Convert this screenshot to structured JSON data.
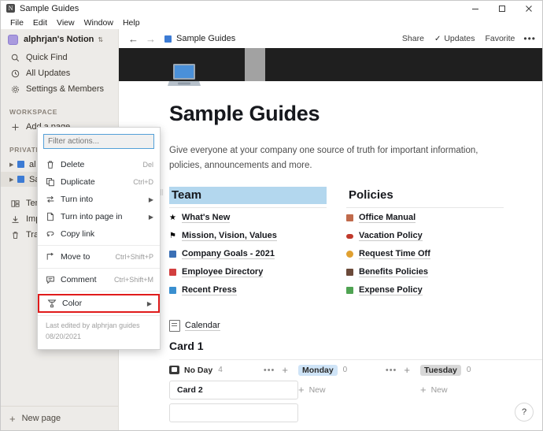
{
  "window": {
    "title": "Sample Guides",
    "app_icon": "notion-logo-icon",
    "minimize": "minimize-icon",
    "maximize": "maximize-icon",
    "close": "close-icon"
  },
  "menubar": {
    "items": [
      "File",
      "Edit",
      "View",
      "Window",
      "Help"
    ]
  },
  "sidebar": {
    "workspace_name": "alphrjan's Notion",
    "nav": [
      {
        "label": "Quick Find",
        "icon": "search-icon"
      },
      {
        "label": "All Updates",
        "icon": "clock-icon"
      },
      {
        "label": "Settings & Members",
        "icon": "gear-icon"
      }
    ],
    "workspace_section": "WORKSPACE",
    "add_page": "Add a page",
    "private_section": "PRIVATE",
    "tree": [
      {
        "label": "al",
        "icon": "page-icon",
        "selected": false
      },
      {
        "label": "Sa",
        "icon": "page-icon",
        "selected": true
      }
    ],
    "bottom": [
      {
        "label": "Temp",
        "icon": "templates-icon"
      },
      {
        "label": "Impo",
        "icon": "import-icon"
      },
      {
        "label": "Trash",
        "icon": "trash-icon"
      }
    ],
    "new_page": "New page"
  },
  "topbar": {
    "back": "back-arrow-icon",
    "forward": "forward-arrow-icon",
    "breadcrumb": "Sample Guides",
    "share": "Share",
    "updates": "Updates",
    "favorite": "Favorite",
    "more": "•••"
  },
  "page": {
    "title": "Sample Guides",
    "description": "Give everyone at your company one source of truth for important information, policies, announcements and more.",
    "cover_icon": "laptop-emoji"
  },
  "columns": [
    {
      "heading": "Team",
      "highlighted": true,
      "links": [
        {
          "label": "What's New",
          "icon": "star-emoji",
          "color": "#f0a81e"
        },
        {
          "label": "Mission, Vision, Values",
          "icon": "flag-emoji",
          "color": "#e04b5a"
        },
        {
          "label": "Company Goals - 2021",
          "icon": "car-emoji",
          "color": "#3a6fb5"
        },
        {
          "label": "Employee Directory",
          "icon": "toolbox-emoji",
          "color": "#d23f3f"
        },
        {
          "label": "Recent Press",
          "icon": "megaphone-emoji",
          "color": "#3a8fd0"
        }
      ]
    },
    {
      "heading": "Policies",
      "highlighted": false,
      "links": [
        {
          "label": "Office Manual",
          "icon": "book-emoji",
          "color": "#c06a4b"
        },
        {
          "label": "Vacation Policy",
          "icon": "car-emoji",
          "color": "#c0392b"
        },
        {
          "label": "Request Time Off",
          "icon": "bell-emoji",
          "color": "#e0a030"
        },
        {
          "label": "Benefits Policies",
          "icon": "coffee-emoji",
          "color": "#6b4a3a"
        },
        {
          "label": "Expense Policy",
          "icon": "money-emoji",
          "color": "#4fa352"
        }
      ]
    }
  ],
  "calendar": {
    "label": "Calendar",
    "card_title": "Card 1"
  },
  "board": {
    "columns": [
      {
        "name": "No Day",
        "count": "4",
        "chip": false,
        "chip_color": "",
        "has_menu": true,
        "cards": [
          "Card 2",
          ""
        ],
        "new_label": ""
      },
      {
        "name": "Monday",
        "count": "0",
        "chip": true,
        "chip_color": "#cfe4f7",
        "has_menu": true,
        "cards": [],
        "new_label": "New"
      },
      {
        "name": "Tuesday",
        "count": "0",
        "chip": true,
        "chip_color": "#d8d8d8",
        "has_menu": false,
        "cards": [],
        "new_label": "New"
      }
    ]
  },
  "context_menu": {
    "filter_placeholder": "Filter actions...",
    "filter_value": "",
    "groups": [
      {
        "items": [
          {
            "label": "Delete",
            "icon": "trash-icon",
            "shortcut": "Del",
            "arrow": false,
            "highlight": false
          },
          {
            "label": "Duplicate",
            "icon": "duplicate-icon",
            "shortcut": "Ctrl+D",
            "arrow": false,
            "highlight": false
          },
          {
            "label": "Turn into",
            "icon": "turn-into-icon",
            "shortcut": "",
            "arrow": true,
            "highlight": false
          },
          {
            "label": "Turn into page in",
            "icon": "page-icon",
            "shortcut": "",
            "arrow": true,
            "highlight": false
          },
          {
            "label": "Copy link",
            "icon": "link-icon",
            "shortcut": "",
            "arrow": false,
            "highlight": false
          }
        ]
      },
      {
        "items": [
          {
            "label": "Move to",
            "icon": "move-to-icon",
            "shortcut": "Ctrl+Shift+P",
            "arrow": false,
            "highlight": false
          }
        ]
      },
      {
        "items": [
          {
            "label": "Comment",
            "icon": "comment-icon",
            "shortcut": "Ctrl+Shift+M",
            "arrow": false,
            "highlight": false
          }
        ]
      },
      {
        "items": [
          {
            "label": "Color",
            "icon": "color-icon",
            "shortcut": "",
            "arrow": true,
            "highlight": true
          }
        ]
      }
    ],
    "footer_line1": "Last edited by alphrjan guides",
    "footer_line2": "08/20/2021",
    "highlight_color": "#e01b1b"
  },
  "help": {
    "label": "?"
  }
}
